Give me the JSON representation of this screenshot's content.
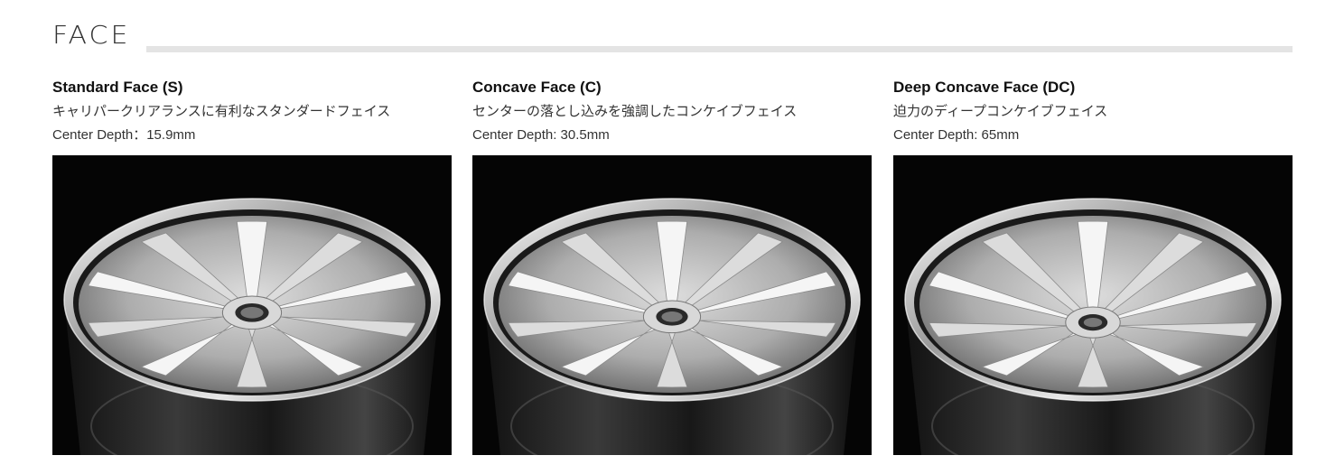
{
  "section": {
    "title": "FACE"
  },
  "faces": [
    {
      "title": "Standard Face (S)",
      "description": "キャリパークリアランスに有利なスタンダードフェイス",
      "depth": "Center Depth：15.9mm",
      "image_alt": "standard-face-wheel-photo"
    },
    {
      "title": "Concave Face (C)",
      "description": "センターの落とし込みを強調したコンケイブフェイス",
      "depth": "Center Depth: 30.5mm",
      "image_alt": "concave-face-wheel-photo"
    },
    {
      "title": "Deep Concave Face (DC)",
      "description": "迫力のディープコンケイブフェイス",
      "depth": "Center Depth: 65mm",
      "image_alt": "deep-concave-face-wheel-photo"
    }
  ],
  "colors": {
    "photo_background": "#050505",
    "rule": "#e4e4e4",
    "wheel_silver": "#c9c9c9"
  }
}
